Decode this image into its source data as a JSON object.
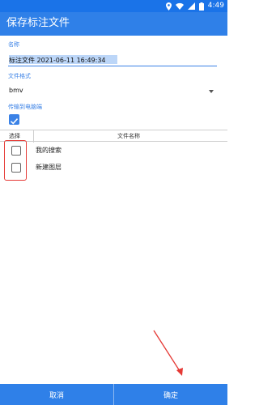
{
  "status_bar": {
    "time": "4:49"
  },
  "app_bar": {
    "title": "保存标注文件"
  },
  "form": {
    "name_label": "名称",
    "name_value": "标注文件 2021-06-11 16:49:34",
    "format_label": "文件格式",
    "format_value": "bmv",
    "upload_label": "传输到电脑端",
    "upload_checked": true
  },
  "table": {
    "headers": [
      "选择",
      "文件名称"
    ],
    "rows": [
      {
        "name": "我的搜索",
        "checked": false
      },
      {
        "name": "新建图层",
        "checked": false
      }
    ]
  },
  "buttons": {
    "cancel": "取消",
    "confirm": "确定"
  },
  "colors": {
    "primary": "#2f80e8",
    "annotation": "#e53935"
  }
}
